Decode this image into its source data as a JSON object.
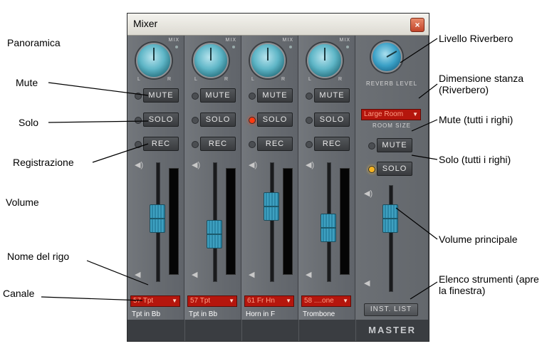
{
  "window": {
    "title": "Mixer",
    "close_icon": "close-icon"
  },
  "channels": [
    {
      "mute": "MUTE",
      "solo": "SOLO",
      "rec": "REC",
      "solo_on": false,
      "pan_label": "MIX",
      "volume_fraction": 0.62,
      "staff_select": "57 Tpt",
      "staff_name": "Tpt in Bb"
    },
    {
      "mute": "MUTE",
      "solo": "SOLO",
      "rec": "REC",
      "solo_on": false,
      "pan_label": "MIX",
      "volume_fraction": 0.42,
      "staff_select": "57 Tpt",
      "staff_name": "Tpt in Bb"
    },
    {
      "mute": "MUTE",
      "solo": "SOLO",
      "rec": "REC",
      "solo_on": true,
      "pan_label": "MIX",
      "volume_fraction": 0.78,
      "staff_select": "61 Fr Hn",
      "staff_name": "Horn in F"
    },
    {
      "mute": "MUTE",
      "solo": "SOLO",
      "rec": "REC",
      "solo_on": false,
      "pan_label": "MIX",
      "volume_fraction": 0.5,
      "staff_select": "58 ....one",
      "staff_name": "Trombone"
    }
  ],
  "master": {
    "reverb_label": "REVERB LEVEL",
    "room_size_value": "Large Room",
    "room_size_label": "ROOM SIZE",
    "mute": "MUTE",
    "solo": "SOLO",
    "solo_all_on": true,
    "volume_fraction": 0.75,
    "inst_list": "INST. LIST",
    "label": "MASTER"
  },
  "annotations": {
    "panoramica": "Panoramica",
    "mute": "Mute",
    "solo": "Solo",
    "registrazione": "Registrazione",
    "volume": "Volume",
    "nome_rigo": "Nome del rigo",
    "canale": "Canale",
    "livello_riverbero": "Livello Riverbero",
    "dimensione_stanza": "Dimensione stanza (Riverbero)",
    "mute_tutti": "Mute (tutti i righi)",
    "solo_tutti": "Solo (tutti i righi)",
    "volume_principale": "Volume principale",
    "elenco_strumenti": "Elenco strumenti (apre la finestra)"
  },
  "colors": {
    "accent_red": "#b5160d",
    "fader_blue": "#3ea0c0",
    "led_red": "#ff3a10",
    "led_amber": "#f5b322"
  }
}
